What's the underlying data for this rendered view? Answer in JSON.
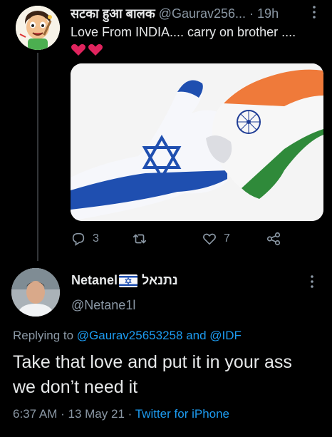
{
  "reply_target_tweet": {
    "display_name": "सटका हुआ बालक",
    "handle": "@Gaurav256...",
    "separator": "·",
    "time": "19h",
    "text": "Love From INDIA.... carry on brother ....",
    "hearts": "❤❤",
    "avatar": "cartoon-boy-avatar",
    "media": "israel-india-flag-handshake-image",
    "actions": {
      "reply_count": "3",
      "retweet_count": "",
      "like_count": "7"
    }
  },
  "main_tweet": {
    "display_name": "Netanel",
    "display_name_suffix": "נתנאל",
    "flag": "israel-flag-emoji",
    "handle": "@Netane1l",
    "replying_prefix": "Replying to",
    "replying_user1": "@Gaurav25653258",
    "replying_and": "and",
    "replying_user2": "@IDF",
    "text": "Take that love and put it in your ass we don’t need it",
    "time": "6:37 AM",
    "separator": "·",
    "date": "13 May 21",
    "separator2": "·",
    "source": "Twitter for iPhone"
  },
  "colors": {
    "background": "#000000",
    "text": "#e7e9ea",
    "secondary": "#8b98a5",
    "link": "#1d9bf0",
    "heart": "#f91880"
  }
}
